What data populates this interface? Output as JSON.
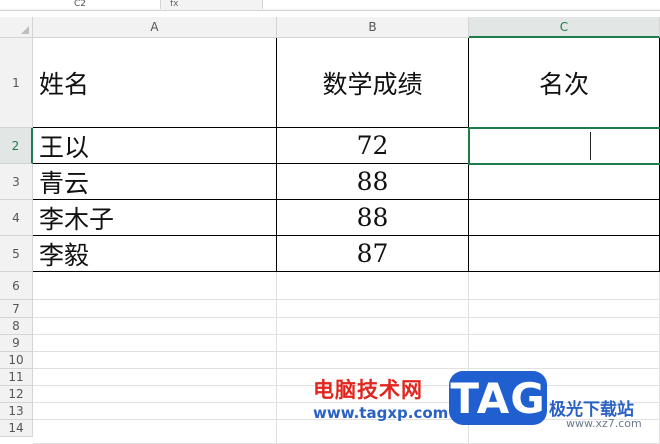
{
  "formula_bar": {
    "name_box": "C2",
    "fx_label": "fx"
  },
  "columns": [
    {
      "label": "A",
      "selected": false
    },
    {
      "label": "B",
      "selected": false
    },
    {
      "label": "C",
      "selected": true
    }
  ],
  "rows": [
    "1",
    "2",
    "3",
    "4",
    "5",
    "6",
    "7",
    "8",
    "9",
    "10",
    "11",
    "12",
    "13",
    "14"
  ],
  "selected_row": "2",
  "table": {
    "headers": [
      "姓名",
      "数学成绩",
      "名次"
    ],
    "records": [
      {
        "name": "王以",
        "score": "72",
        "rank": ""
      },
      {
        "name": "青云",
        "score": "88",
        "rank": ""
      },
      {
        "name": "李木子",
        "score": "88",
        "rank": ""
      },
      {
        "name": "李毅",
        "score": "87",
        "rank": ""
      }
    ]
  },
  "watermark": {
    "cn_title": "电脑技术网",
    "url": "www.tagxp.com",
    "badge": "TAG",
    "cn_sub": "极光下载站",
    "url2": "www.xz7.com"
  },
  "colors": {
    "selection": "#1e7c4a",
    "badge": "#1f5fcf",
    "wm_red": "#e0261e"
  }
}
